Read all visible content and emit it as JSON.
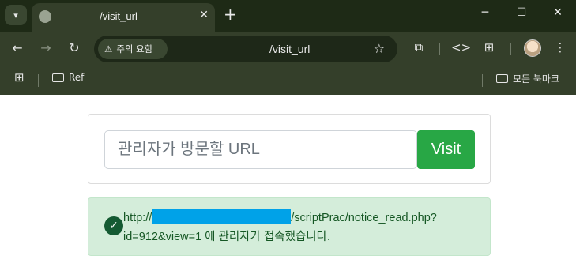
{
  "tab": {
    "title": "/visit_url",
    "close": "✕"
  },
  "window": {
    "new_tab": "+",
    "minimize": "─",
    "maximize": "☐",
    "close": "✕"
  },
  "nav": {
    "back": "←",
    "forward": "→",
    "reload": "↻"
  },
  "omnibox": {
    "security_chip": "주의 요함",
    "warning_icon": "⚠",
    "url": "/visit_url",
    "star": "☆"
  },
  "toolbar": {
    "extensions": "⧉",
    "devtools": "<>",
    "translate": "⊞",
    "menu": "⋮"
  },
  "bookmarks": {
    "apps": "⊞",
    "items": [
      {
        "label": "Ref"
      }
    ],
    "all_bookmarks": "모든 북마크"
  },
  "form": {
    "placeholder": "관리자가 방문할 URL",
    "submit_label": "Visit"
  },
  "alert": {
    "prefix": "http://",
    "suffix": "/scriptPrac/notice_read.php?id=912&view=1 에 관리자가 접속했습니다.",
    "icon": "✓"
  }
}
